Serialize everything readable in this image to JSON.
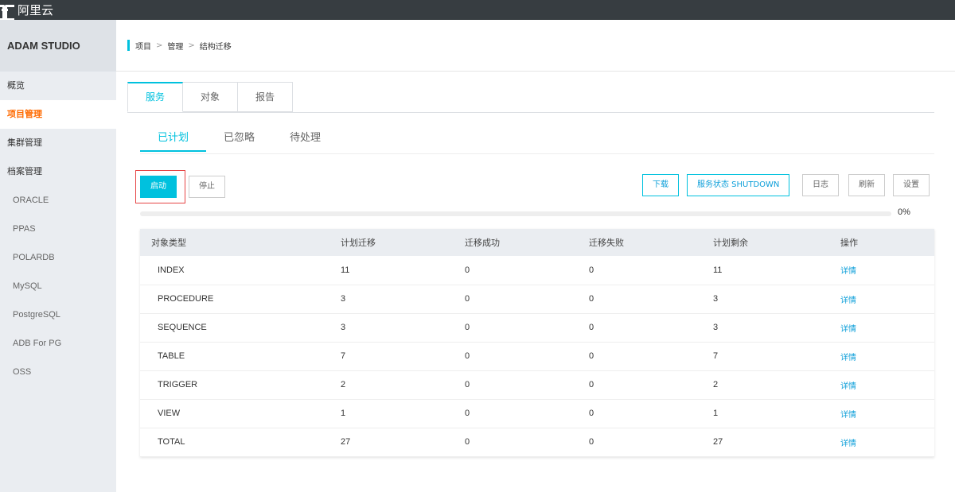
{
  "topbar": {
    "logo_text": "阿里云"
  },
  "sidebar": {
    "brand": "ADAM STUDIO",
    "items": [
      {
        "label": "概览"
      },
      {
        "label": "项目管理"
      },
      {
        "label": "集群管理"
      },
      {
        "label": "档案管理"
      },
      {
        "label": "ORACLE"
      },
      {
        "label": "PPAS"
      },
      {
        "label": "POLARDB"
      },
      {
        "label": "MySQL"
      },
      {
        "label": "PostgreSQL"
      },
      {
        "label": "ADB For PG"
      },
      {
        "label": "OSS"
      }
    ]
  },
  "breadcrumb": [
    "项目",
    "管理",
    "结构迁移"
  ],
  "breadcrumb_sep": ">",
  "tabs": [
    "服务",
    "对象",
    "报告"
  ],
  "subtabs": [
    "已计划",
    "已忽略",
    "待处理"
  ],
  "buttons": {
    "start": "启动",
    "stop": "停止",
    "download": "下载",
    "service_status": "服务状态 SHUTDOWN",
    "log": "日志",
    "refresh": "刷新",
    "settings": "设置"
  },
  "progress": {
    "value": 0,
    "label": "0%"
  },
  "table": {
    "headers": [
      "对象类型",
      "计划迁移",
      "迁移成功",
      "迁移失败",
      "计划剩余",
      "操作"
    ],
    "rows": [
      [
        "INDEX",
        "11",
        "0",
        "0",
        "11",
        "详情"
      ],
      [
        "PROCEDURE",
        "3",
        "0",
        "0",
        "3",
        "详情"
      ],
      [
        "SEQUENCE",
        "3",
        "0",
        "0",
        "3",
        "详情"
      ],
      [
        "TABLE",
        "7",
        "0",
        "0",
        "7",
        "详情"
      ],
      [
        "TRIGGER",
        "2",
        "0",
        "0",
        "2",
        "详情"
      ],
      [
        "VIEW",
        "1",
        "0",
        "0",
        "1",
        "详情"
      ],
      [
        "TOTAL",
        "27",
        "0",
        "0",
        "27",
        "详情"
      ]
    ]
  },
  "colors": {
    "accent": "#00c1de",
    "active_nav": "#ff6a00",
    "topbar": "#373d41",
    "link": "#0d9fd9"
  }
}
